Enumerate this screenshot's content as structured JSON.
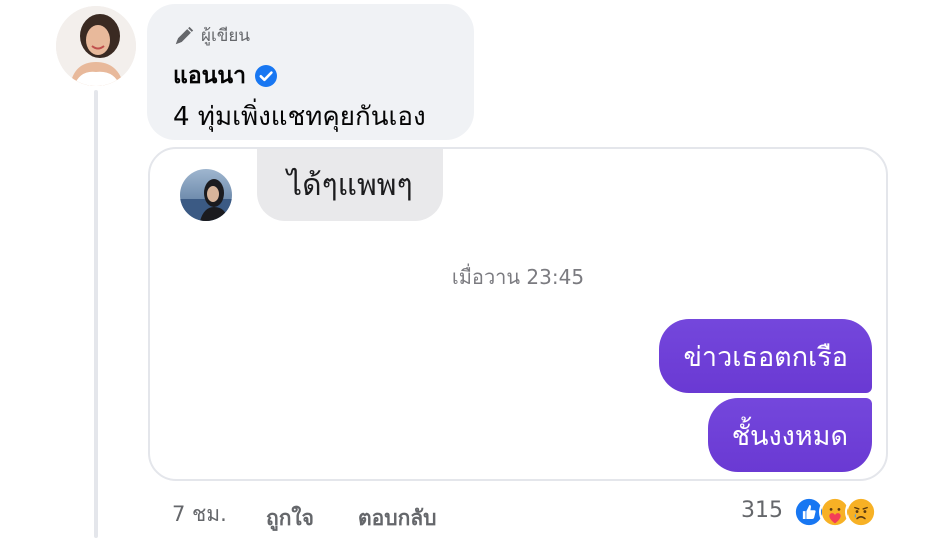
{
  "comment": {
    "author_tag": "ผู้เขียน",
    "author_name": "แอนนา",
    "text": "4 ทุ่มเพิ่งแชทคุยกันเอง"
  },
  "attachment": {
    "incoming_message": "ได้ๆแพพๆ",
    "timestamp": "เมื่อวาน 23:45",
    "outgoing_messages": [
      "ข่าวเธอตกเรือ",
      "ชั้นงงหมด"
    ],
    "outgoing_color": "#6e3ad8"
  },
  "footer": {
    "time_ago": "7 ชม.",
    "like_label": "ถูกใจ",
    "reply_label": "ตอบกลับ",
    "reaction_count": "315",
    "reactions": [
      "like-icon",
      "care-icon",
      "sad-icon"
    ]
  },
  "colors": {
    "verified": "#1877f2",
    "bubble_bg": "#f0f2f5",
    "muted_text": "#65676b"
  }
}
